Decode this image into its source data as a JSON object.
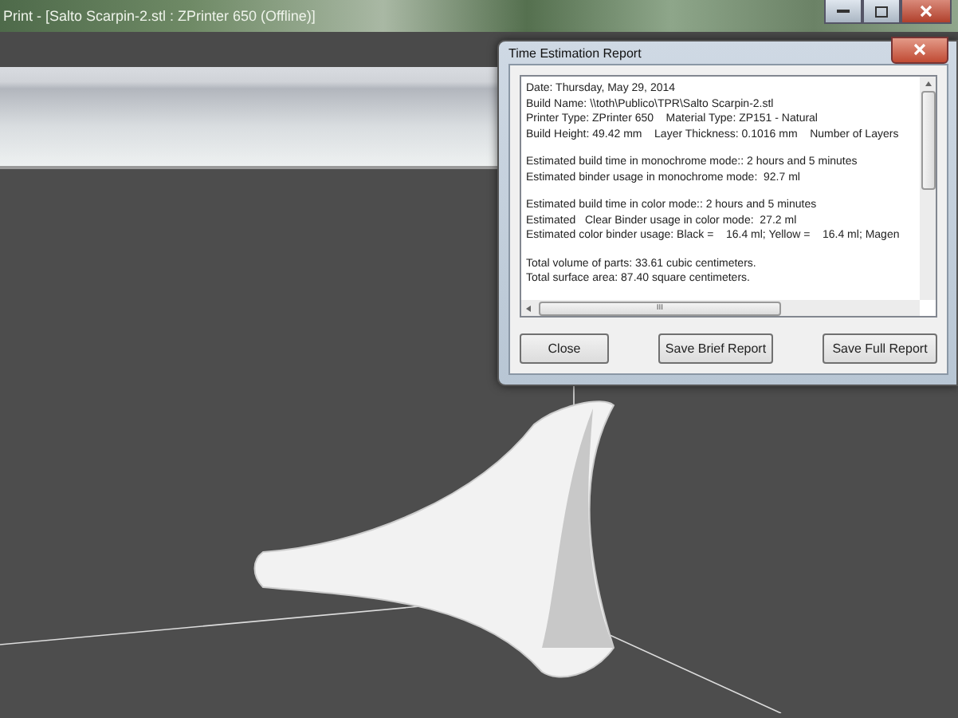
{
  "window": {
    "title": "Print - [Salto Scarpin-2.stl : ZPrinter 650 (Offline)]"
  },
  "dialog": {
    "title": "Time Estimation Report",
    "paragraphs": [
      [
        "Date: Thursday, May 29, 2014",
        "Build Name: \\\\toth\\Publico\\TPR\\Salto Scarpin-2.stl",
        "Printer Type: ZPrinter 650    Material Type: ZP151 - Natural",
        "Build Height: 49.42 mm    Layer Thickness: 0.1016 mm    Number of Layers"
      ],
      [
        "Estimated build time in monochrome mode:: 2 hours and 5 minutes",
        "Estimated binder usage in monochrome mode:  92.7 ml"
      ],
      [
        "Estimated build time in color mode:: 2 hours and 5 minutes",
        "Estimated   Clear Binder usage in color mode:  27.2 ml",
        "Estimated color binder usage: Black =    16.4 ml; Yellow =    16.4 ml; Magen"
      ],
      [
        "Total volume of parts: 33.61 cubic centimeters.",
        "Total surface area: 87.40 square centimeters."
      ]
    ],
    "scroll_grip": "III",
    "buttons": [
      "Close",
      "Save Brief Report",
      "Save Full Report"
    ]
  }
}
